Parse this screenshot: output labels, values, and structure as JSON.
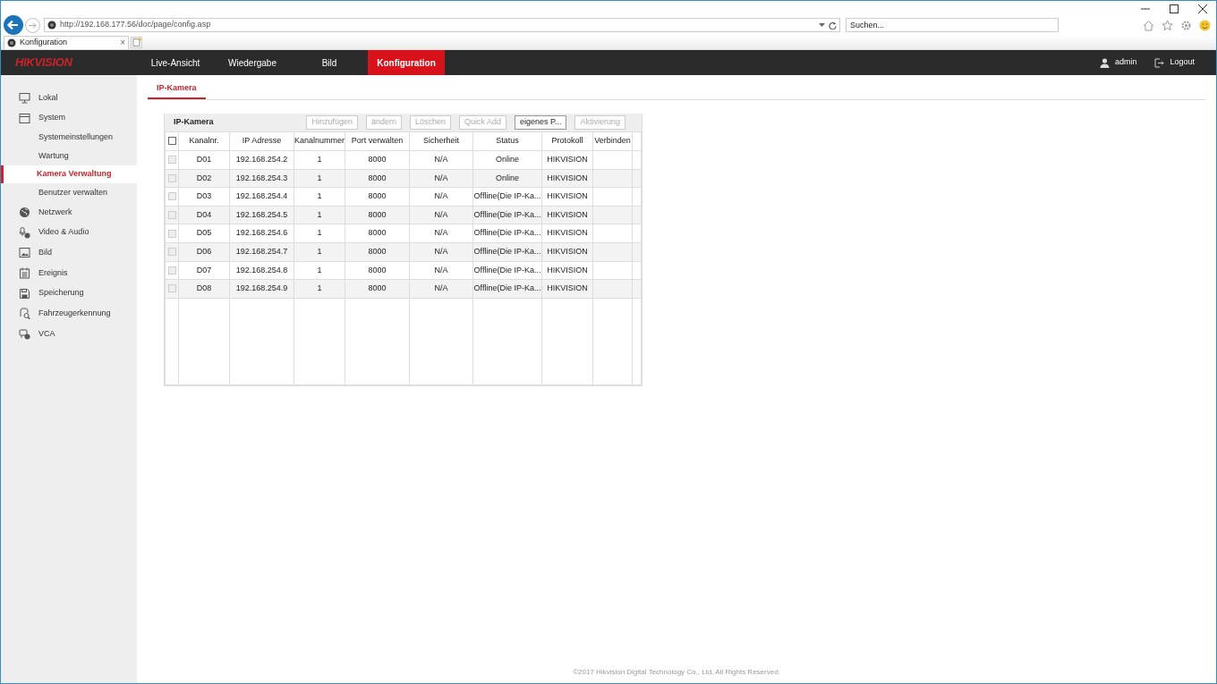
{
  "browser": {
    "address": "http://192.168.177.56/doc/page/config.asp",
    "search_placeholder": "Suchen...",
    "tab": {
      "title": "Konfiguration",
      "close": "×"
    }
  },
  "nav": {
    "logo": "HIKVISION",
    "items": [
      {
        "label": "Live-Ansicht",
        "selected": false
      },
      {
        "label": "Wiedergabe",
        "selected": false
      },
      {
        "label": "Bild",
        "selected": false
      },
      {
        "label": "Konfiguration",
        "selected": true
      }
    ],
    "user": "admin",
    "logout": "Logout"
  },
  "sidebar": {
    "items": [
      {
        "label": "Lokal",
        "selected": false
      },
      {
        "label": "System",
        "selected": false,
        "children": [
          {
            "label": "Systemeinstellungen",
            "selected": false
          },
          {
            "label": "Wartung",
            "selected": false
          },
          {
            "label": "Kamera Verwaltung",
            "selected": true
          },
          {
            "label": "Benutzer verwalten",
            "selected": false
          }
        ]
      },
      {
        "label": "Netzwerk",
        "selected": false
      },
      {
        "label": "Video & Audio",
        "selected": false
      },
      {
        "label": "Bild",
        "selected": false
      },
      {
        "label": "Ereignis",
        "selected": false
      },
      {
        "label": "Speicherung",
        "selected": false
      },
      {
        "label": "Fahrzeugerkennung",
        "selected": false
      },
      {
        "label": "VCA",
        "selected": false
      }
    ]
  },
  "tabs": [
    {
      "label": "IP-Kamera",
      "selected": true
    }
  ],
  "panel": {
    "title": "IP-Kamera",
    "buttons": [
      {
        "label": "Hinzufügen",
        "disabled": true
      },
      {
        "label": "ändern",
        "disabled": true
      },
      {
        "label": "Löschen",
        "disabled": true
      },
      {
        "label": "Quick Add",
        "disabled": true
      },
      {
        "label": "eigenes P...",
        "disabled": false
      },
      {
        "label": "Aktivierung",
        "disabled": true
      }
    ]
  },
  "table": {
    "select_all": {
      "checked": false
    },
    "columns": [
      "Kanalnr.",
      "IP Adresse",
      "Kanalnummer",
      "Port verwalten",
      "Sicherheit",
      "Status",
      "Protokoll",
      "Verbinden"
    ],
    "rows": [
      {
        "checked": false,
        "cells": [
          "D01",
          "192.168.254.2",
          "1",
          "8000",
          "N/A",
          "Online",
          "HIKVISION"
        ]
      },
      {
        "checked": false,
        "cells": [
          "D02",
          "192.168.254.3",
          "1",
          "8000",
          "N/A",
          "Online",
          "HIKVISION"
        ]
      },
      {
        "checked": false,
        "cells": [
          "D03",
          "192.168.254.4",
          "1",
          "8000",
          "N/A",
          "Offline(Die IP-Ka...",
          "HIKVISION"
        ]
      },
      {
        "checked": false,
        "cells": [
          "D04",
          "192.168.254.5",
          "1",
          "8000",
          "N/A",
          "Offline(Die IP-Ka...",
          "HIKVISION"
        ]
      },
      {
        "checked": false,
        "cells": [
          "D05",
          "192.168.254.6",
          "1",
          "8000",
          "N/A",
          "Offline(Die IP-Ka...",
          "HIKVISION"
        ]
      },
      {
        "checked": false,
        "cells": [
          "D06",
          "192.168.254.7",
          "1",
          "8000",
          "N/A",
          "Offline(Die IP-Ka...",
          "HIKVISION"
        ]
      },
      {
        "checked": false,
        "cells": [
          "D07",
          "192.168.254.8",
          "1",
          "8000",
          "N/A",
          "Offline(Die IP-Ka...",
          "HIKVISION"
        ]
      },
      {
        "checked": false,
        "cells": [
          "D08",
          "192.168.254.9",
          "1",
          "8000",
          "N/A",
          "Offline(Die IP-Ka...",
          "HIKVISION"
        ]
      }
    ]
  },
  "footer": "©2017 Hikvision Digital Technology Co., Ltd. All Rights Reserved."
}
